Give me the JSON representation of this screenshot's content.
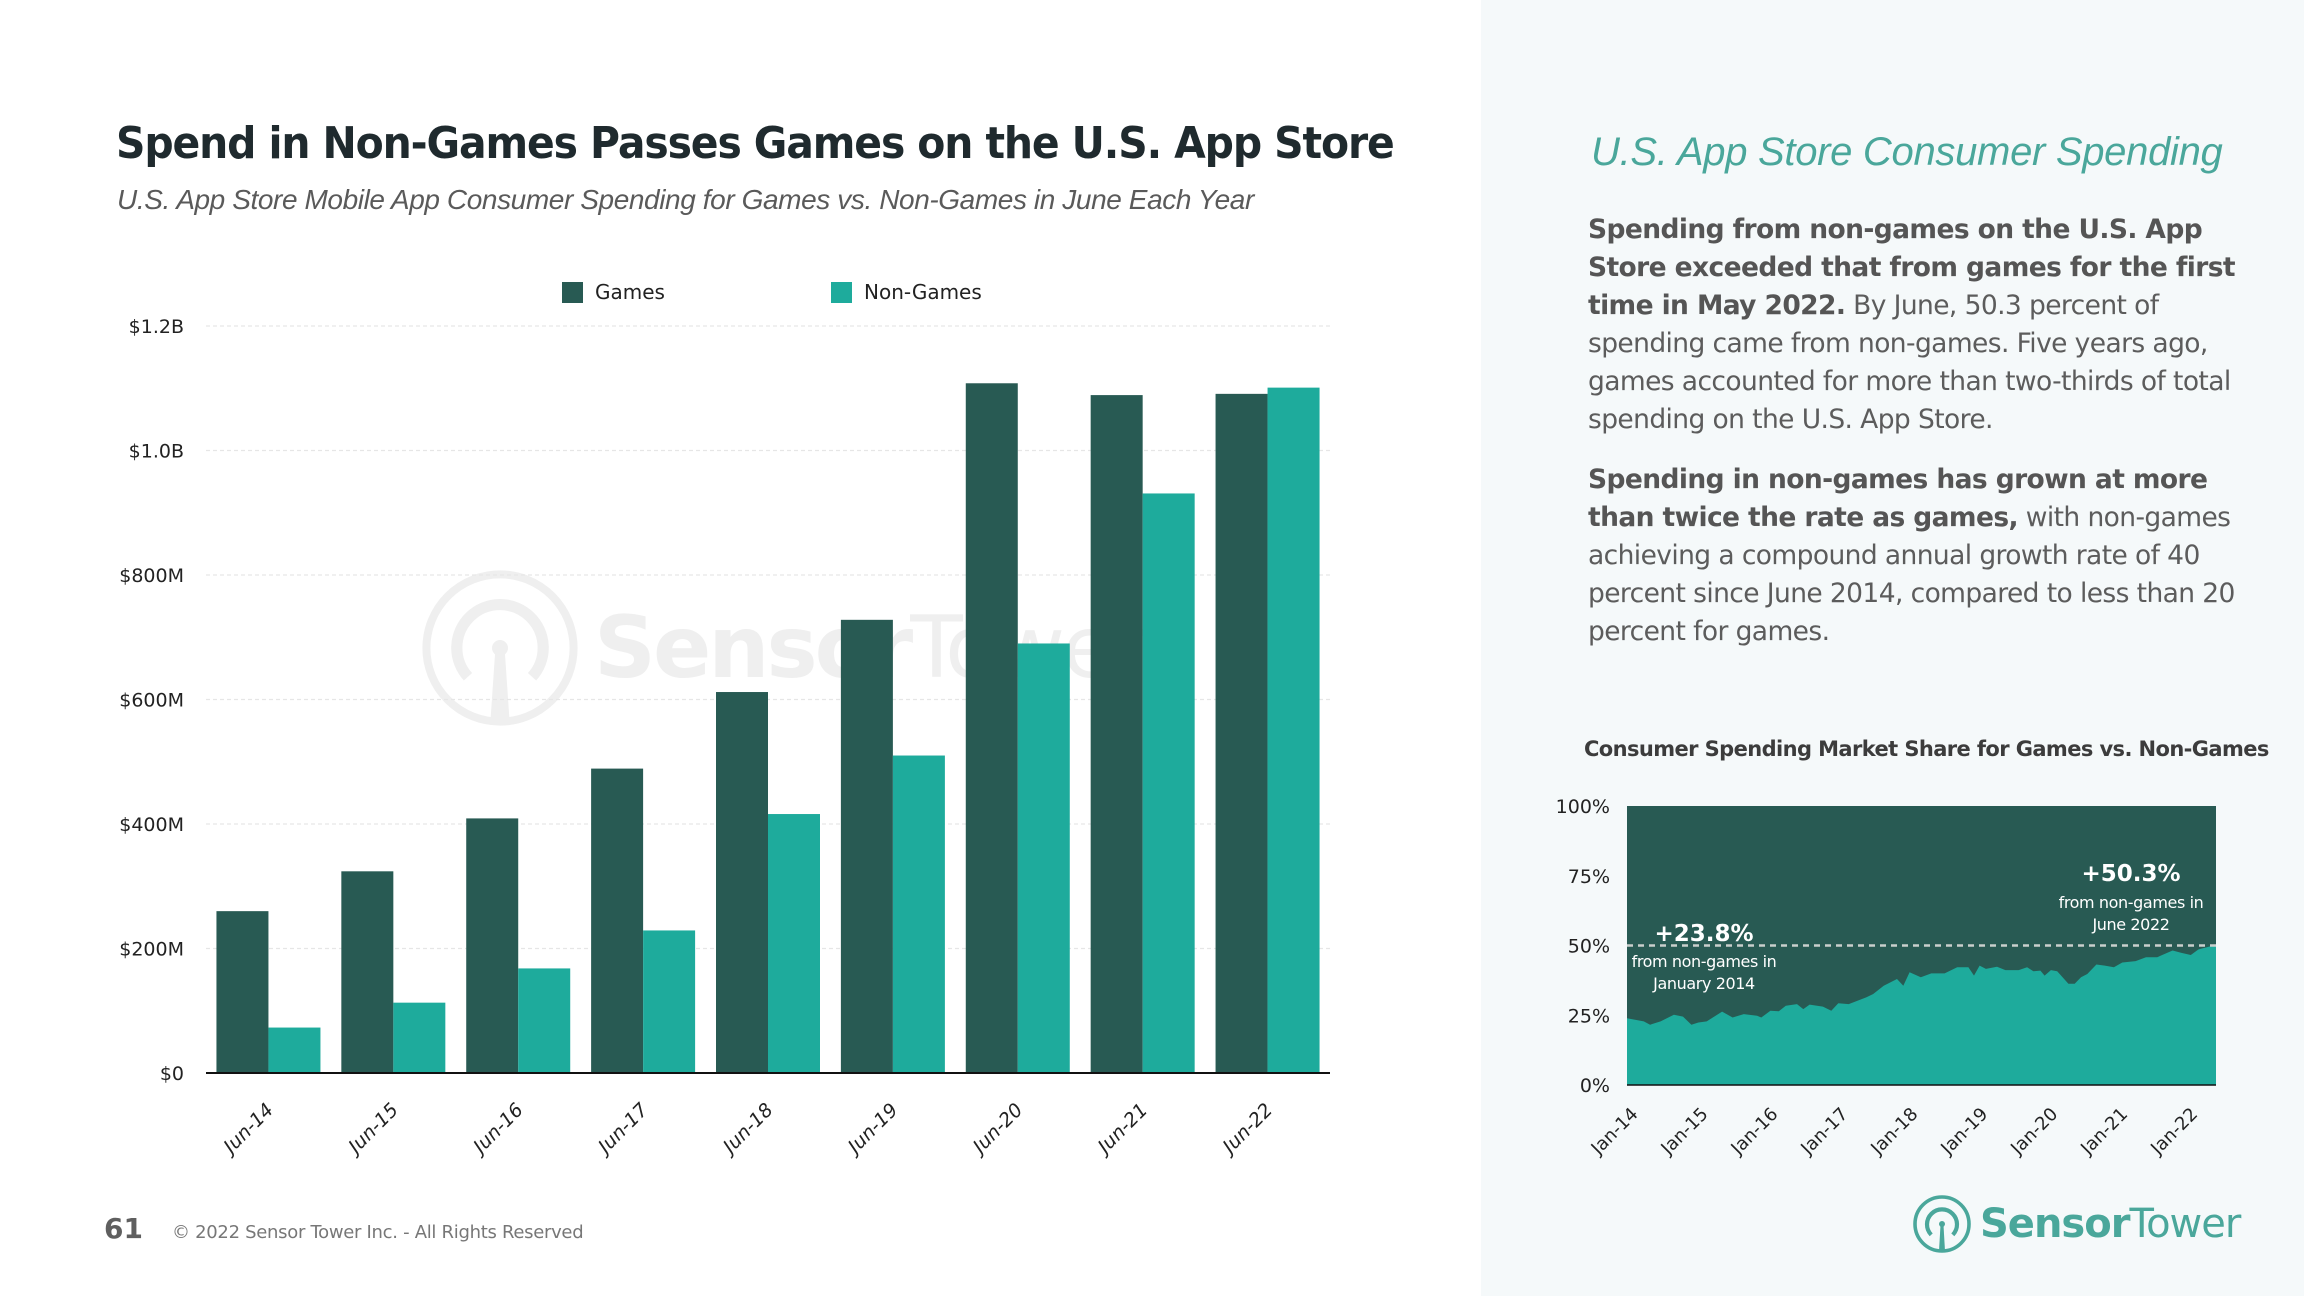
{
  "header": {
    "title": "Spend in Non-Games Passes Games on the U.S. App Store",
    "subtitle": "U.S. App Store Mobile App Consumer Spending for Games vs. Non-Games in June Each Year"
  },
  "colors": {
    "games": "#285a53",
    "non_games": "#1eab9c",
    "accent": "#4aa79b",
    "panel_bg": "#f5f9fa"
  },
  "watermark": {
    "bold": "Sensor",
    "light": "Tower",
    "icon": "sensor-tower-logo-icon"
  },
  "chart_data": [
    {
      "type": "bar",
      "title": "U.S. App Store Mobile App Consumer Spending for Games vs. Non-Games in June Each Year",
      "xlabel": "",
      "ylabel": "",
      "categories": [
        "Jun-14",
        "Jun-15",
        "Jun-16",
        "Jun-17",
        "Jun-18",
        "Jun-19",
        "Jun-20",
        "Jun-21",
        "Jun-22"
      ],
      "series": [
        {
          "name": "Games",
          "color": "#285a53",
          "values": [
            260,
            324,
            409,
            489,
            612,
            728,
            1108,
            1089,
            1091
          ]
        },
        {
          "name": "Non-Games",
          "color": "#1eab9c",
          "values": [
            73,
            113,
            168,
            229,
            416,
            510,
            690,
            931,
            1101
          ]
        }
      ],
      "units": "USD millions",
      "ylim": [
        0,
        1200
      ],
      "yticks": [
        0,
        200,
        400,
        600,
        800,
        1000,
        1200
      ],
      "ytick_labels": [
        "$0",
        "$200M",
        "$400M",
        "$600M",
        "$800M",
        "$1.0B",
        "$1.2B"
      ],
      "grid": true,
      "legend": "top-center"
    },
    {
      "type": "area",
      "title": "Consumer Spending Market Share for Games vs. Non-Games",
      "xlabel": "",
      "ylabel": "",
      "xtick_labels": [
        "Jan-14",
        "Jan-15",
        "Jan-16",
        "Jan-17",
        "Jan-18",
        "Jan-19",
        "Jan-20",
        "Jan-21",
        "Jan-22"
      ],
      "xrange": [
        2014.0,
        2022.42
      ],
      "ylim": [
        0,
        100
      ],
      "yticks": [
        0,
        25,
        50,
        75,
        100
      ],
      "ytick_labels": [
        "0%",
        "25%",
        "50%",
        "75%",
        "100%"
      ],
      "series": [
        {
          "name": "Non-Games share (%)",
          "color": "#1eab9c",
          "x": [
            2014.0,
            2014.24,
            2014.33,
            2014.48,
            2014.67,
            2014.8,
            2014.92,
            2015.02,
            2015.14,
            2015.36,
            2015.51,
            2015.67,
            2015.86,
            2015.92,
            2016.05,
            2016.17,
            2016.27,
            2016.43,
            2016.52,
            2016.61,
            2016.8,
            2016.92,
            2017.02,
            2017.17,
            2017.42,
            2017.52,
            2017.67,
            2017.86,
            2017.95,
            2018.04,
            2018.2,
            2018.35,
            2018.54,
            2018.72,
            2018.88,
            2018.96,
            2019.04,
            2019.13,
            2019.29,
            2019.41,
            2019.6,
            2019.72,
            2019.81,
            2019.91,
            2019.97,
            2020.06,
            2020.15,
            2020.31,
            2020.4,
            2020.49,
            2020.58,
            2020.71,
            2020.83,
            2020.96,
            2021.08,
            2021.27,
            2021.42,
            2021.58,
            2021.8,
            2021.92,
            2022.06,
            2022.17,
            2022.29,
            2022.42
          ],
          "values": [
            23.9,
            22.8,
            21.6,
            22.8,
            25.2,
            24.5,
            21.6,
            22.4,
            22.8,
            26.3,
            24.2,
            25.4,
            24.8,
            24.2,
            26.6,
            26.4,
            28.4,
            29.0,
            27.2,
            28.8,
            28.1,
            26.6,
            29.3,
            29.0,
            31.4,
            32.6,
            35.6,
            38.0,
            35.6,
            40.4,
            38.6,
            40.0,
            40.0,
            42.2,
            42.2,
            39.2,
            42.8,
            41.6,
            42.4,
            41.2,
            41.2,
            42.2,
            40.8,
            41.0,
            39.2,
            41.2,
            40.8,
            36.3,
            36.3,
            38.6,
            39.8,
            43.2,
            42.8,
            42.2,
            43.9,
            44.4,
            45.8,
            45.8,
            48.2,
            47.4,
            46.6,
            48.6,
            49.4,
            50.3
          ]
        },
        {
          "name": "Games share (%)",
          "color": "#285a53",
          "note": "remainder to 100%"
        }
      ],
      "reference_line": {
        "y": 50,
        "style": "dashed"
      },
      "annotations": [
        {
          "value": "+23.8%",
          "text_line1": "from non-games in",
          "text_line2": "January 2014"
        },
        {
          "value": "+50.3%",
          "text_line1": "from non-games in",
          "text_line2": "June 2022"
        }
      ]
    }
  ],
  "right_panel": {
    "heading": "U.S. App Store Consumer Spending",
    "para1_bold": "Spending from non-games on the U.S. App Store exceeded that from games for the first time in May 2022.",
    "para1_text": " By June, 50.3 percent of spending came from non-games. Five years ago, games accounted for more than two-thirds of total spending on the U.S. App Store.",
    "para2_bold": "Spending in non-games has grown at more than twice the rate as games,",
    "para2_text": " with non-games achieving a compound annual growth rate of 40 percent since June 2014, compared to less than 20 percent for games."
  },
  "footer": {
    "page_number": "61",
    "copyright": "© 2022 Sensor Tower Inc. - All Rights Reserved"
  },
  "logo": {
    "bold": "Sensor",
    "light": "Tower",
    "icon": "sensor-tower-logo-icon"
  }
}
